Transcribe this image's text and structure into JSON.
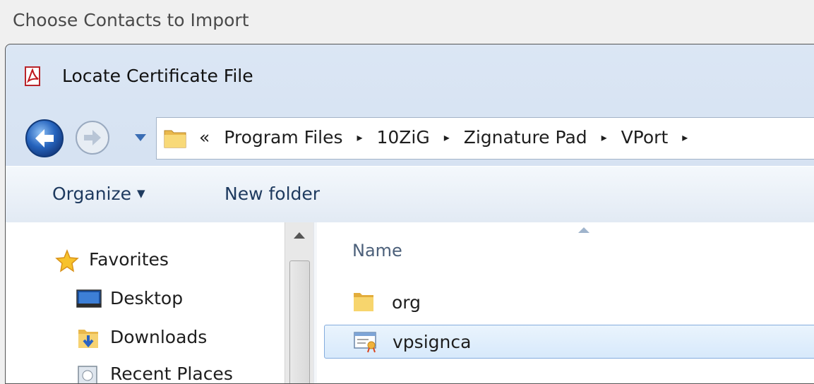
{
  "outer_window": {
    "title": "Choose Contacts to Import"
  },
  "dialog": {
    "title": "Locate Certificate File",
    "icon": "pdf-icon"
  },
  "navigation": {
    "back_icon": "back-arrow-icon",
    "forward_icon": "forward-arrow-icon",
    "history_icon": "chevron-down-icon",
    "breadcrumb": {
      "overflow": "«",
      "items": [
        "Program Files",
        "10ZiG",
        "Zignature Pad",
        "VPort"
      ],
      "separator": "▸"
    }
  },
  "toolbar": {
    "organize_label": "Organize",
    "organize_caret": "▼",
    "new_folder_label": "New folder"
  },
  "nav_pane": {
    "favorites_label": "Favorites",
    "items": [
      {
        "label": "Desktop",
        "icon": "desktop-icon"
      },
      {
        "label": "Downloads",
        "icon": "downloads-folder-icon"
      },
      {
        "label": "Recent Places",
        "icon": "recent-places-icon"
      }
    ]
  },
  "file_list": {
    "column_name": "Name",
    "files": [
      {
        "name": "org",
        "icon": "folder-icon",
        "selected": false
      },
      {
        "name": "vpsignca",
        "icon": "certificate-icon",
        "selected": true
      }
    ]
  },
  "colors": {
    "accent": "#3a78c9",
    "selection": "#d7e9fb",
    "selection_border": "#84acdd"
  }
}
